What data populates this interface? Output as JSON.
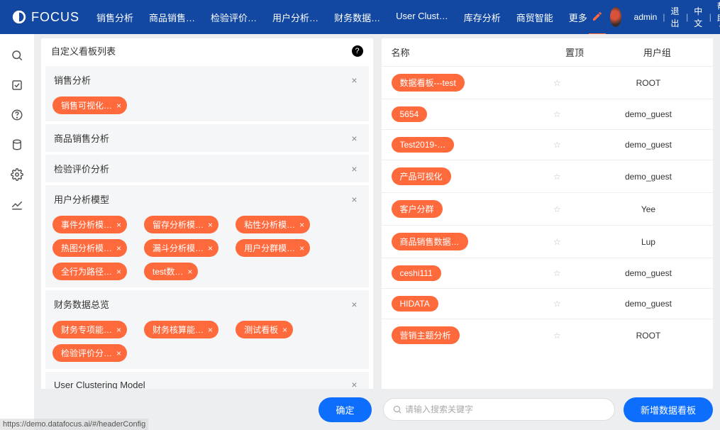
{
  "header": {
    "brand": "FOCUS",
    "nav": [
      "销售分析",
      "商品销售…",
      "检验评价…",
      "用户分析…",
      "财务数据…",
      "User Clust…",
      "库存分析",
      "商贸智能",
      "更多"
    ],
    "user": "admin",
    "logout": "退出",
    "lang": "中文",
    "help": "帮助"
  },
  "left": {
    "title": "自定义看板列表",
    "groups": [
      {
        "name": "销售分析",
        "chips": [
          "销售可视化…"
        ]
      },
      {
        "name": "商品销售分析",
        "chips": []
      },
      {
        "name": "检验评价分析",
        "chips": []
      },
      {
        "name": "用户分析模型",
        "chips": [
          "事件分析模…",
          "留存分析模…",
          "粘性分析模…",
          "热图分析模…",
          "漏斗分析模…",
          "用户分群模…",
          "全行为路径…",
          "test数…"
        ]
      },
      {
        "name": "财务数据总览",
        "chips": [
          "财务专项能…",
          "财务核算能…",
          "测试看板",
          "检验评价分…"
        ]
      },
      {
        "name": "User Clustering Model",
        "chips": []
      }
    ]
  },
  "right": {
    "cols": {
      "name": "名称",
      "pin": "置顶",
      "group": "用户组"
    },
    "rows": [
      {
        "name": "数据看板---test",
        "group": "ROOT"
      },
      {
        "name": "5654",
        "group": "demo_guest"
      },
      {
        "name": "Test2019-…",
        "group": "demo_guest"
      },
      {
        "name": "产品可视化",
        "group": "demo_guest"
      },
      {
        "name": "客户分群",
        "group": "Yee"
      },
      {
        "name": "商品销售数据…",
        "group": "Lup"
      },
      {
        "name": "ceshi111",
        "group": "demo_guest"
      },
      {
        "name": "HIDATA",
        "group": "demo_guest"
      },
      {
        "name": "营销主题分析",
        "group": "ROOT"
      }
    ]
  },
  "footer": {
    "confirm": "确定",
    "search_placeholder": "请输入搜索关键字",
    "add": "新增数据看板"
  },
  "status_url": "https://demo.datafocus.ai/#/headerConfig"
}
